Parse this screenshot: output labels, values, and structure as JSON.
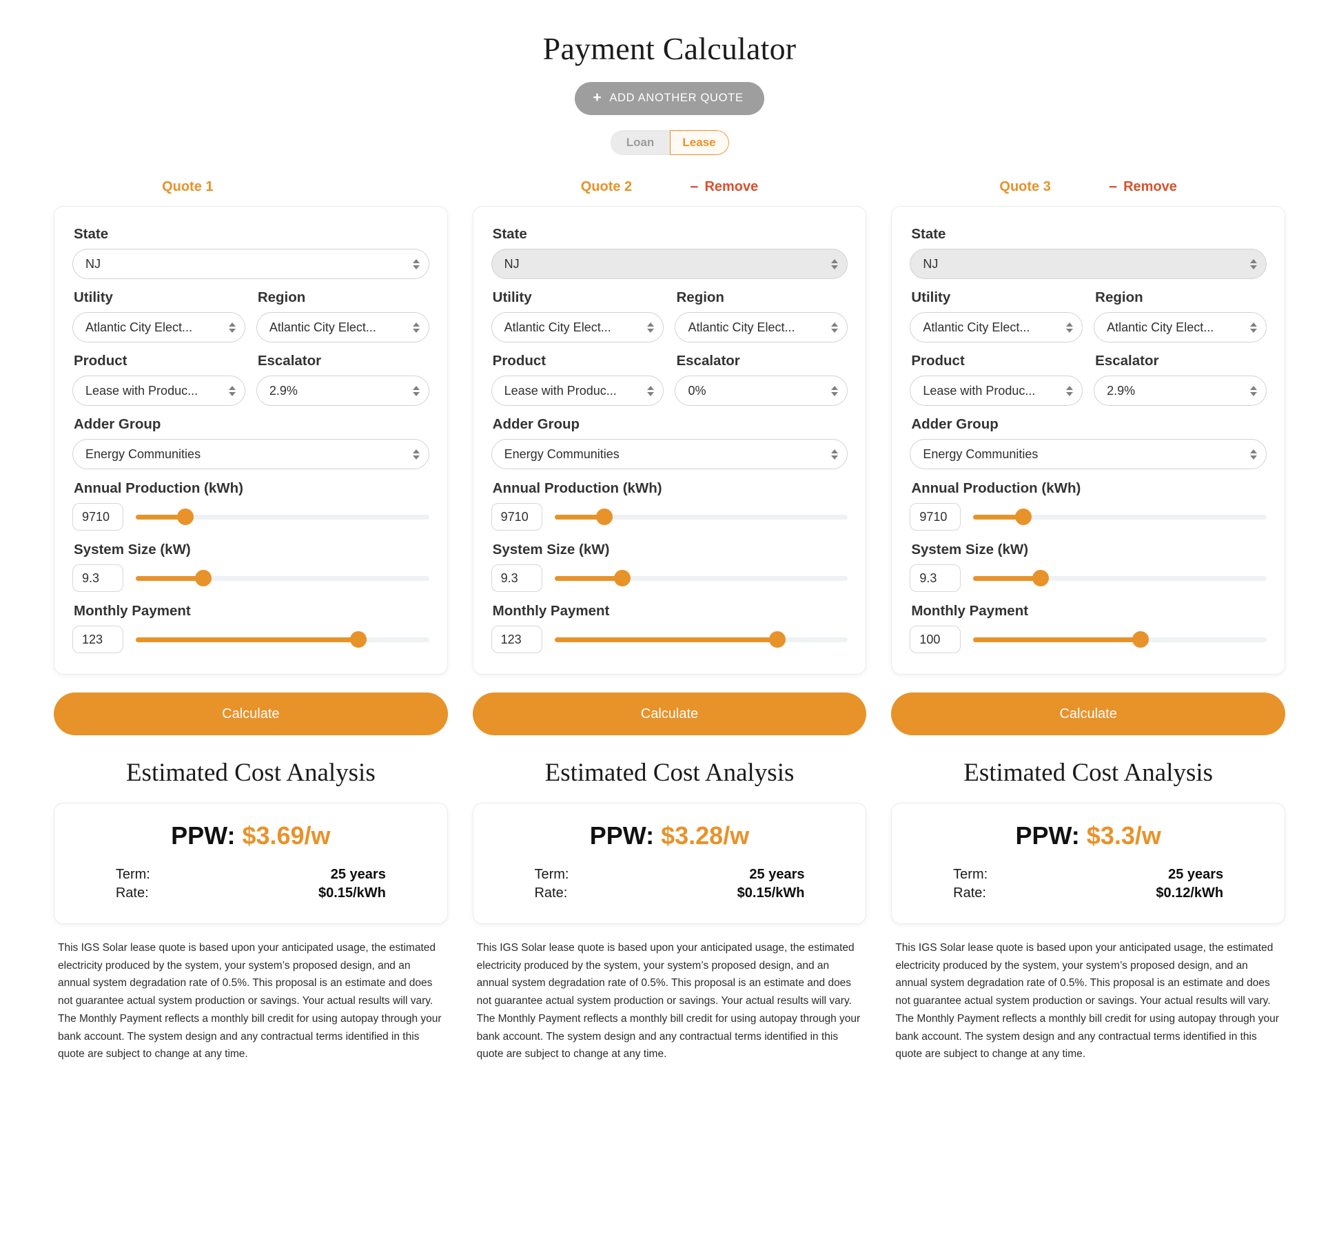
{
  "header": {
    "title": "Payment Calculator",
    "add_quote_label": "ADD ANOTHER QUOTE",
    "plus_glyph": "+",
    "toggle": {
      "loan_label": "Loan",
      "lease_label": "Lease",
      "selected": "Lease"
    }
  },
  "labels": {
    "state": "State",
    "utility": "Utility",
    "region": "Region",
    "product": "Product",
    "escalator": "Escalator",
    "adder_group": "Adder Group",
    "annual_production": "Annual Production (kWh)",
    "system_size": "System Size (kW)",
    "monthly_payment": "Monthly Payment",
    "calculate": "Calculate",
    "analysis_title": "Estimated Cost Analysis",
    "ppw_prefix": "PPW: ",
    "term_key": "Term:",
    "rate_key": "Rate:",
    "remove": "Remove",
    "minus_glyph": "−"
  },
  "colors": {
    "accent": "#e8922a",
    "remove": "#d9512c",
    "button_gray": "#9e9e9e",
    "track": "#eef2f4"
  },
  "disclaimer": "This IGS Solar lease quote is based upon your anticipated usage, the estimated electricity produced by the system, your system’s proposed design, and an annual system degradation rate of 0.5%. This proposal is an estimate and does not guarantee actual system production or savings. Your actual results will vary. The Monthly Payment reflects a monthly bill credit for using autopay through your bank account. The system design and any contractual terms identified in this quote are subject to change at any time.",
  "quotes": [
    {
      "title": "Quote 1",
      "removable": false,
      "state": "NJ",
      "state_muted": false,
      "utility": "Atlantic City Elect...",
      "region": "Atlantic City Elect...",
      "product": "Lease with Produc...",
      "escalator": "2.9%",
      "adder_group": "Energy Communities",
      "annual_production": "9710",
      "annual_production_pct": 17,
      "system_size": "9.3",
      "system_size_pct": 23,
      "monthly_payment": "123",
      "monthly_payment_pct": 76,
      "ppw": "$3.69/w",
      "term": "25 years",
      "rate": "$0.15/kWh"
    },
    {
      "title": "Quote 2",
      "removable": true,
      "state": "NJ",
      "state_muted": true,
      "utility": "Atlantic City Elect...",
      "region": "Atlantic City Elect...",
      "product": "Lease with Produc...",
      "escalator": "0%",
      "adder_group": "Energy Communities",
      "annual_production": "9710",
      "annual_production_pct": 17,
      "system_size": "9.3",
      "system_size_pct": 23,
      "monthly_payment": "123",
      "monthly_payment_pct": 76,
      "ppw": "$3.28/w",
      "term": "25 years",
      "rate": "$0.15/kWh"
    },
    {
      "title": "Quote 3",
      "removable": true,
      "state": "NJ",
      "state_muted": true,
      "utility": "Atlantic City Elect...",
      "region": "Atlantic City Elect...",
      "product": "Lease with Produc...",
      "escalator": "2.9%",
      "adder_group": "Energy Communities",
      "annual_production": "9710",
      "annual_production_pct": 17,
      "system_size": "9.3",
      "system_size_pct": 23,
      "monthly_payment": "100",
      "monthly_payment_pct": 57,
      "ppw": "$3.3/w",
      "term": "25 years",
      "rate": "$0.12/kWh"
    }
  ]
}
